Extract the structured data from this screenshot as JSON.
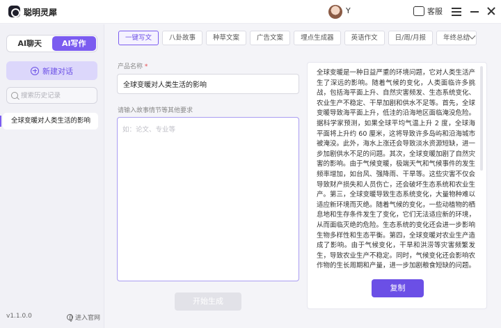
{
  "app": {
    "title": "聪明灵犀",
    "username": "Y",
    "service_label": "客服"
  },
  "sidebar": {
    "modes": [
      "AI聊天",
      "AI写作"
    ],
    "active_mode": "AI写作",
    "new_chat_label": "新建对话",
    "search_placeholder": "搜索历史记录",
    "history": [
      {
        "label": "全球变暖对人类生活的影响"
      }
    ],
    "version": "v1.1.0.0",
    "official_site_label": "进入官网"
  },
  "tabs": {
    "items": [
      "一键写文",
      "八卦故事",
      "种草文案",
      "广告文案",
      "埋点生成器",
      "英语作文",
      "日/周/月报",
      "年终总结"
    ],
    "active": "一键写文"
  },
  "form": {
    "product_name_label": "产品名称",
    "required_mark": "*",
    "product_name_value": "全球变暖对人类生活的影响",
    "requirement_label": "请输入故事情节等其他要求",
    "requirement_placeholder": "如：论文、专业等",
    "generate_label": "开始生成"
  },
  "output": {
    "text": "全球变暖是一种日益严重的环境问题，它对人类生活产生了深远的影响。随着气候的变化，人类面临许多挑战，包括海平面上升、自然灾害频发、生态系统变化、农业生产不稳定、干旱加剧和供水不足等。首先，全球变暖导致海平面上升，低洼的沿海地区面临淹没危险。据科学家预测，如果全球平均气温上升 2 度，全球海平面将上升约 60 厘米，这将导致许多岛屿和沿海城市被淹没。此外，海水上涨还会导致淡水资源短缺，进一步加剧供水不足的问题。其次，全球变暖加剧了自然灾害的影响。由于气候变暖，极端天气和气候事件的发生频率增加，如台风、强降雨、干旱等。这些灾害不仅会导致财产损失和人员伤亡，还会破坏生态系统和农业生产。第三，全球变暖导致生态系统变化，大量物种难以适应新环境而灭绝。随着气候的变化，一些动植物的栖息地和生存条件发生了变化，它们无法适应新的环境，从而面临灭绝的危险。生态系统的变化还会进一步影响生物多样性和生态平衡。第四，全球变暖对农业生产造成了影响。由于气候变化，干旱和洪涝等灾害频繁发生，导致农业生产不稳定。同时，气候变化还会影响农作物的生长周期和产量，进一步加剧粮食短缺的问题。最后，全球变暖对人类健康造成了威胁。气候变化",
    "copy_label": "复制"
  }
}
